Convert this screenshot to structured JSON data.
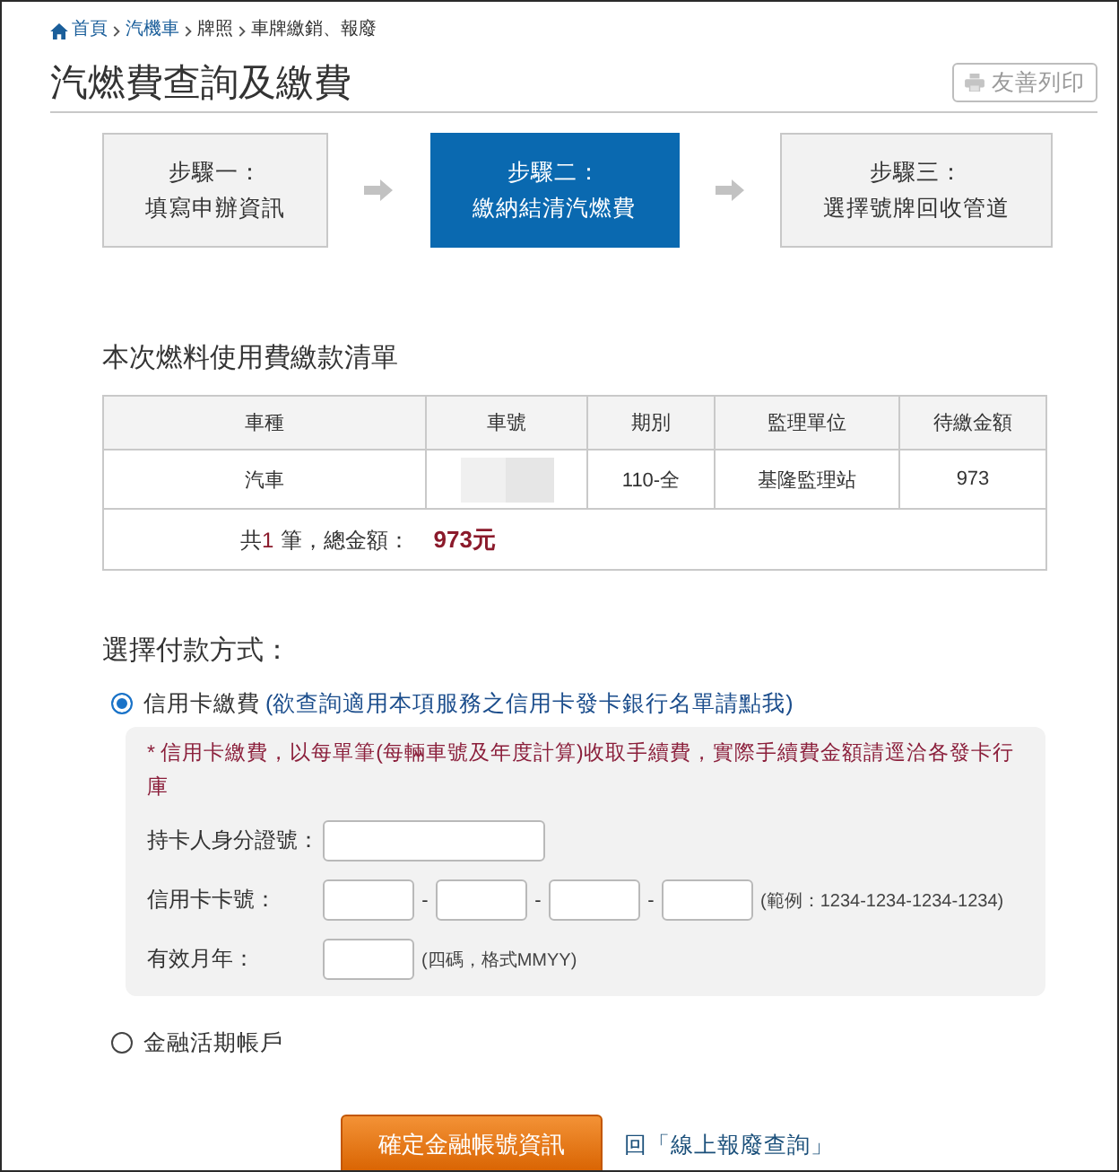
{
  "breadcrumb": [
    {
      "kind": "home",
      "label": "首頁"
    },
    {
      "kind": "link",
      "label": "汽機車"
    },
    {
      "kind": "text",
      "label": "牌照"
    },
    {
      "kind": "text",
      "label": "車牌繳銷、報廢"
    }
  ],
  "page_title": "汽燃費查詢及繳費",
  "print_button": "友善列印",
  "steps": [
    {
      "title": "步驟一：",
      "subtitle": "填寫申辦資訊",
      "selected": false
    },
    {
      "title": "步驟二：",
      "subtitle": "繳納結清汽燃費",
      "selected": true
    },
    {
      "title": "步驟三：",
      "subtitle": "選擇號牌回收管道",
      "selected": false
    }
  ],
  "fee_list": {
    "heading": "本次燃料使用費繳款清單",
    "columns": [
      "車種",
      "車號",
      "期別",
      "監理單位",
      "待繳金額"
    ],
    "rows": [
      {
        "cells": [
          {
            "kind": "text",
            "text": "汽車"
          },
          {
            "kind": "redacted"
          },
          {
            "kind": "text",
            "text": "110-全"
          },
          {
            "kind": "text",
            "text": "基隆監理站"
          },
          {
            "kind": "text",
            "text": "973"
          }
        ]
      }
    ],
    "total": {
      "prefix": "共",
      "count": "1",
      "suffix": "筆，總金額：",
      "amount": "973元"
    }
  },
  "payment": {
    "heading": "選擇付款方式：",
    "options": [
      {
        "kind": "card",
        "label": "信用卡繳費",
        "link": "(欲查詢適用本項服務之信用卡發卡銀行名單請點我)",
        "selected": true,
        "note": "* 信用卡繳費，以每單筆(每輛車號及年度計算)收取手續費，實際手續費金額請逕洽各發卡行庫",
        "fields": [
          {
            "kind": "wide",
            "label": "持卡人身分證號："
          },
          {
            "kind": "segments",
            "label": "信用卡卡號：",
            "separators": [
              "-",
              "-",
              "-"
            ],
            "hint": "(範例：1234-1234-1234-1234)"
          },
          {
            "kind": "short",
            "label": "有效月年：",
            "hint": "(四碼，格式MMYY)"
          }
        ]
      },
      {
        "kind": "account",
        "label": "金融活期帳戶",
        "selected": false
      }
    ]
  },
  "actions": {
    "confirm_button": "確定金融帳號資訊",
    "back_link": "回「線上報廢查詢」"
  }
}
